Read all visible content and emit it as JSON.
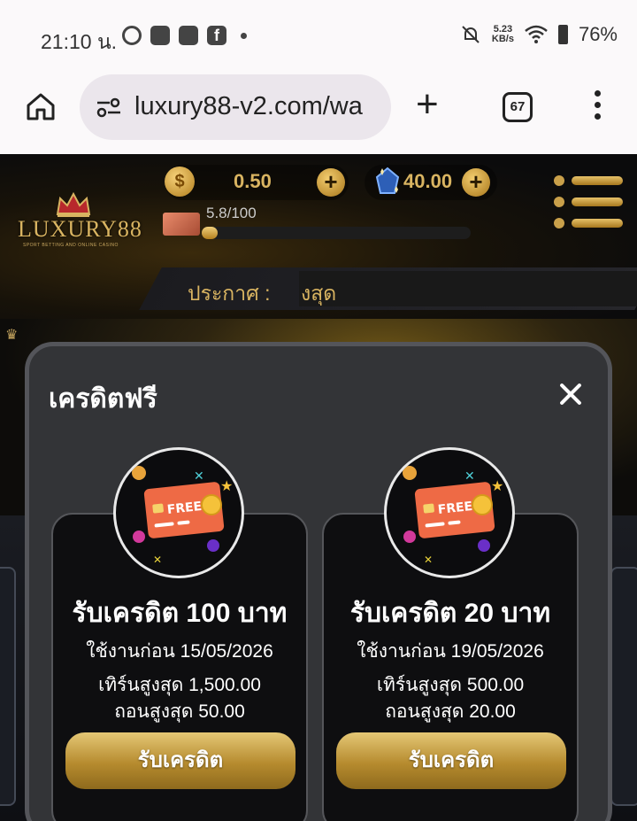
{
  "status_bar": {
    "time": "21:10 น.",
    "net_speed_value": "5.23",
    "net_speed_unit": "KB/s",
    "battery": "76%",
    "notification_icons": [
      "threads-icon",
      "mail-icon",
      "app-icon",
      "facebook-icon"
    ]
  },
  "browser": {
    "url": "luxury88-v2.com/wa",
    "tab_count": "67"
  },
  "game": {
    "logo_text": "LUXURY88",
    "logo_sub": "SPORT BETTING AND ONLINE CASINO",
    "coin_balance": "0.50",
    "gem_balance": "40.00",
    "level_progress_text": "5.8/100",
    "level_progress_fraction": 0.058,
    "announce_label": "ประกาศ :",
    "announce_text": "งสุด"
  },
  "modal": {
    "title": "เครดิตฟรี",
    "badge_text": "FREE",
    "cards": [
      {
        "title": "รับเครดิต 100 บาท",
        "expiry": "ใช้งานก่อน 15/05/2026",
        "max_turnover": "เทิร์นสูงสุด 1,500.00",
        "max_withdraw": "ถอนสูงสุด 50.00",
        "button": "รับเครดิต"
      },
      {
        "title": "รับเครดิต 20 บาท",
        "expiry": "ใช้งานก่อน 19/05/2026",
        "max_turnover": "เทิร์นสูงสุด 500.00",
        "max_withdraw": "ถอนสูงสุด 20.00",
        "button": "รับเครดิต"
      }
    ]
  },
  "colors": {
    "gold": "#d9b461",
    "modal_bg": "#333437",
    "card_bg": "#0e0e10"
  }
}
